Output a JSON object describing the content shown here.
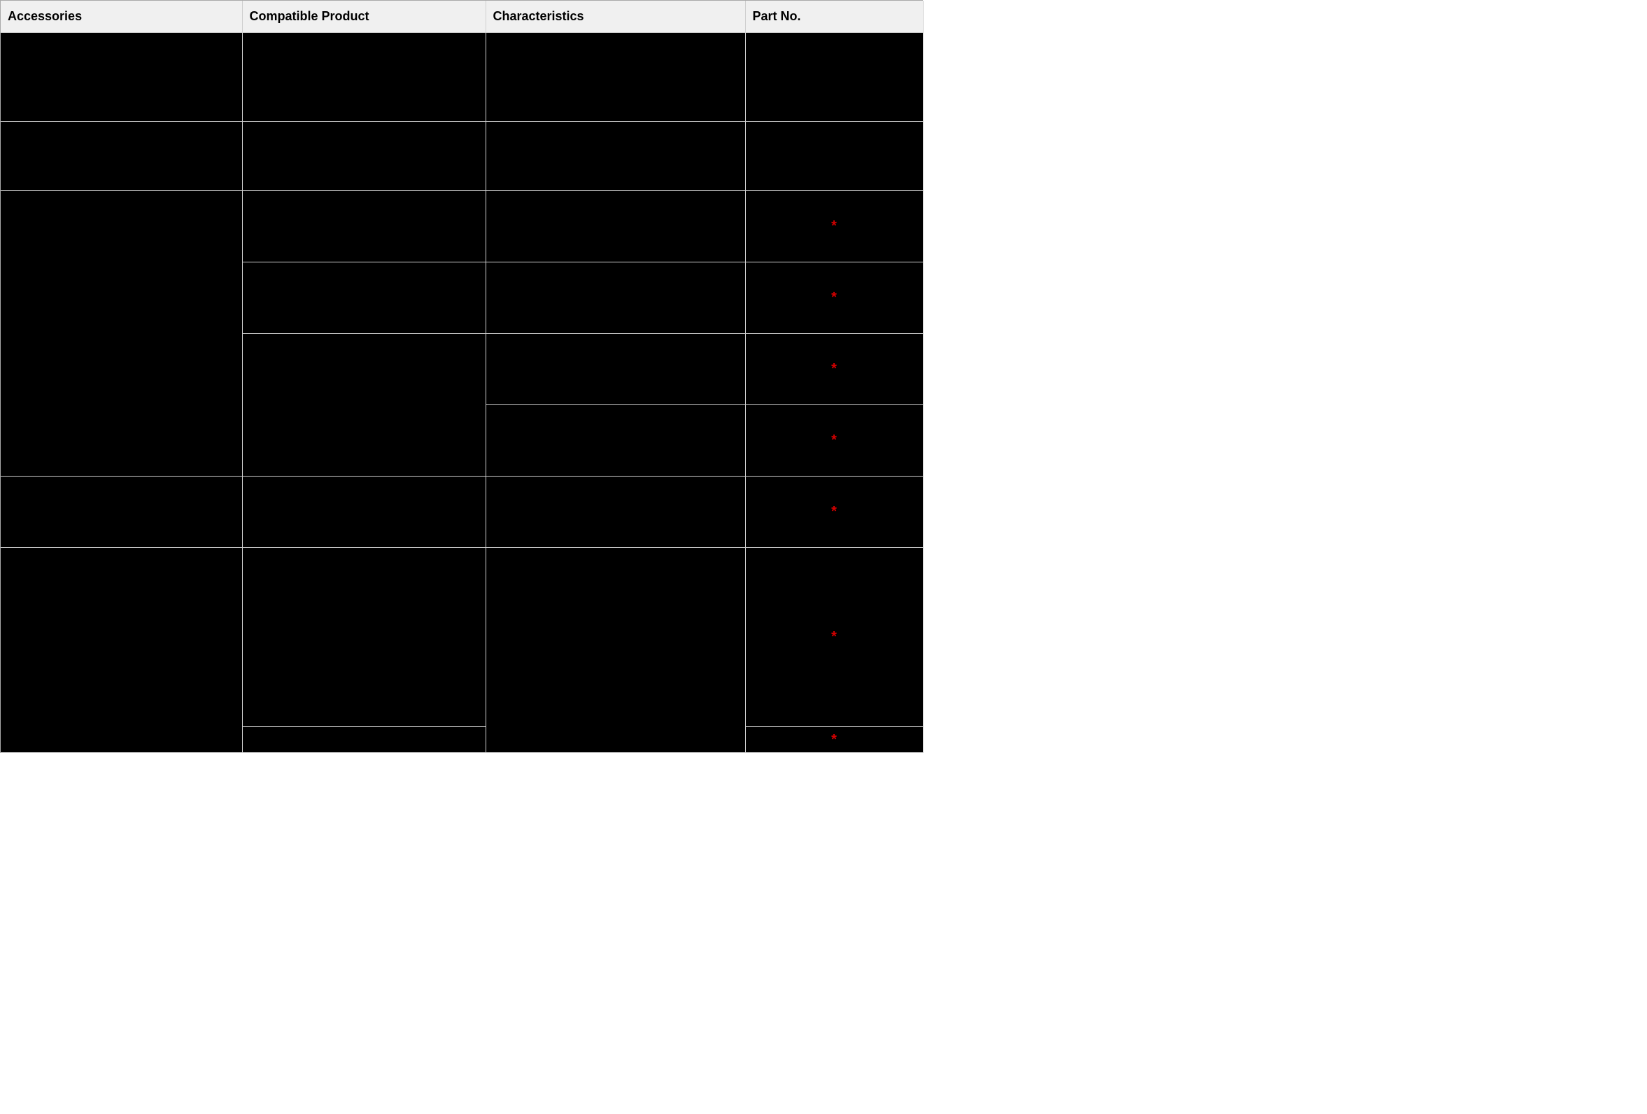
{
  "table": {
    "headers": [
      "Accessories",
      "Compatible Product",
      "Characteristics",
      "Part No."
    ],
    "star_glyph": "*",
    "rows": [
      {
        "accessories": "",
        "compatible_product": "",
        "characteristics": "",
        "part_no": "",
        "has_star": false,
        "accessories_rowspan": 1,
        "compatible_product_rowspan": 1,
        "characteristics_rowspan": 1
      },
      {
        "accessories": "",
        "compatible_product": "",
        "characteristics": "",
        "part_no": "",
        "has_star": false,
        "accessories_rowspan": 1,
        "compatible_product_rowspan": 1,
        "characteristics_rowspan": 1
      },
      {
        "accessories": "",
        "compatible_product": "",
        "characteristics": "",
        "part_no": "",
        "has_star": true,
        "accessories_rowspan": 4,
        "compatible_product_rowspan": 1,
        "characteristics_rowspan": 1
      },
      {
        "compatible_product": "",
        "characteristics": "",
        "part_no": "",
        "has_star": true,
        "compatible_product_rowspan": 1,
        "characteristics_rowspan": 1
      },
      {
        "compatible_product": "",
        "characteristics": "",
        "part_no": "",
        "has_star": true,
        "compatible_product_rowspan": 2,
        "characteristics_rowspan": 1
      },
      {
        "characteristics": "",
        "part_no": "",
        "has_star": true,
        "characteristics_rowspan": 1
      },
      {
        "accessories": "",
        "compatible_product": "",
        "characteristics": "",
        "part_no": "",
        "has_star": true,
        "accessories_rowspan": 1,
        "compatible_product_rowspan": 1,
        "characteristics_rowspan": 1
      },
      {
        "accessories": "",
        "compatible_product": "",
        "characteristics": "",
        "part_no": "",
        "has_star": true,
        "accessories_rowspan": 2,
        "compatible_product_rowspan": 1,
        "characteristics_rowspan": 2
      },
      {
        "compatible_product": "",
        "part_no": "",
        "has_star": true,
        "compatible_product_rowspan": 1
      }
    ]
  }
}
